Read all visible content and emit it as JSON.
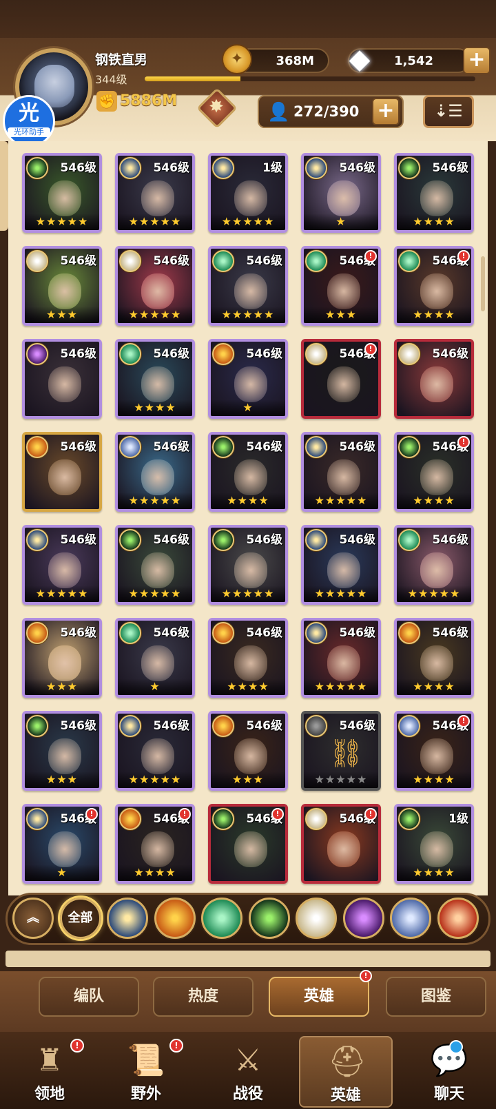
{
  "player": {
    "name": "钢铁直男",
    "level": "344级",
    "level_progress": 0.29,
    "power": "5886M"
  },
  "helper_badge": {
    "glyph": "光",
    "label": "光环助手"
  },
  "currency": {
    "gold": "368M",
    "diamonds": "1,542"
  },
  "roster": {
    "count": "272/390"
  },
  "icons": {
    "plus": "+",
    "sort": "⇣☰",
    "coin": "✦",
    "gem": "◆",
    "person": "👤",
    "power": "✊",
    "emblem_star": "✸",
    "chain": "⛓",
    "alert": "!"
  },
  "heroes": [
    {
      "faction": "graveborn",
      "level": "546级",
      "stars": "★★★★★",
      "border": "purple",
      "hue": "#3a5a2a",
      "alert": false
    },
    {
      "faction": "lightbearer-star",
      "level": "546级",
      "stars": "★★★★★",
      "border": "purple",
      "hue": "#3a3a4a",
      "alert": false
    },
    {
      "faction": "lightbearer-star",
      "level": "1级",
      "stars": "★★★★★",
      "border": "purple",
      "hue": "#2a2a38",
      "alert": false
    },
    {
      "faction": "lightbearer-star",
      "level": "546级",
      "stars": "★",
      "border": "purple",
      "hue": "#7a6a8a",
      "alert": false
    },
    {
      "faction": "graveborn",
      "level": "546级",
      "stars": "★★★★",
      "border": "purple",
      "hue": "#2a3a3a",
      "alert": false
    },
    {
      "faction": "celestial",
      "level": "546级",
      "stars": "★★★",
      "border": "purple",
      "hue": "#6a8a3a",
      "alert": false
    },
    {
      "faction": "celestial",
      "level": "546级",
      "stars": "★★★★★",
      "border": "purple",
      "hue": "#a03a4a",
      "alert": false
    },
    {
      "faction": "wilder",
      "level": "546级",
      "stars": "★★★★★",
      "border": "purple",
      "hue": "#3a3a48",
      "alert": false
    },
    {
      "faction": "wilder",
      "level": "546级",
      "stars": "★★★",
      "border": "purple",
      "hue": "#3a1a1a",
      "alert": true
    },
    {
      "faction": "wilder",
      "level": "546级",
      "stars": "★★★★",
      "border": "purple",
      "hue": "#5a3a2a",
      "alert": true
    },
    {
      "faction": "hypogean",
      "level": "546级",
      "stars": "",
      "border": "purple",
      "hue": "#3a3038",
      "alert": false
    },
    {
      "faction": "wilder",
      "level": "546级",
      "stars": "★★★★",
      "border": "purple",
      "hue": "#2a4a5a",
      "alert": false
    },
    {
      "faction": "mauler",
      "level": "546级",
      "stars": "★",
      "border": "purple",
      "hue": "#2a2a4a",
      "alert": false
    },
    {
      "faction": "celestial",
      "level": "546级",
      "stars": "",
      "border": "red",
      "hue": "#1a1a1a",
      "alert": true
    },
    {
      "faction": "celestial",
      "level": "546级",
      "stars": "",
      "border": "red",
      "hue": "#8a3a3a",
      "alert": false
    },
    {
      "faction": "mauler",
      "level": "546级",
      "stars": "",
      "border": "gold",
      "hue": "#6a4a2a",
      "alert": false
    },
    {
      "faction": "dimensional",
      "level": "546级",
      "stars": "★★★★★",
      "border": "purple",
      "hue": "#3a6a8a",
      "alert": false
    },
    {
      "faction": "graveborn",
      "level": "546级",
      "stars": "★★★★",
      "border": "purple",
      "hue": "#2a2a2a",
      "alert": false
    },
    {
      "faction": "lightbearer-star",
      "level": "546级",
      "stars": "★★★★★",
      "border": "purple",
      "hue": "#3a2a28",
      "alert": false
    },
    {
      "faction": "graveborn",
      "level": "546级",
      "stars": "★★★★",
      "border": "purple",
      "hue": "#2a3028",
      "alert": true
    },
    {
      "faction": "lightbearer-star",
      "level": "546级",
      "stars": "★★★★★",
      "border": "purple",
      "hue": "#4a3a5a",
      "alert": false
    },
    {
      "faction": "graveborn",
      "level": "546级",
      "stars": "★★★★★",
      "border": "purple",
      "hue": "#3a4a3a",
      "alert": false
    },
    {
      "faction": "graveborn",
      "level": "546级",
      "stars": "★★★★★",
      "border": "purple",
      "hue": "#4a4a4a",
      "alert": false
    },
    {
      "faction": "lightbearer-star",
      "level": "546级",
      "stars": "★★★★★",
      "border": "purple",
      "hue": "#2a3a5a",
      "alert": false
    },
    {
      "faction": "wilder",
      "level": "546级",
      "stars": "★★★★★",
      "border": "purple",
      "hue": "#8a5a6a",
      "alert": false
    },
    {
      "faction": "mauler",
      "level": "546级",
      "stars": "★★★",
      "border": "purple",
      "hue": "#c0a070",
      "alert": false
    },
    {
      "faction": "wilder",
      "level": "546级",
      "stars": "★",
      "border": "purple",
      "hue": "#3a3a4a",
      "alert": false
    },
    {
      "faction": "mauler",
      "level": "546级",
      "stars": "★★★★",
      "border": "purple",
      "hue": "#3a2a20",
      "alert": false
    },
    {
      "faction": "lightbearer-star",
      "level": "546级",
      "stars": "★★★★★",
      "border": "purple",
      "hue": "#6a2a2a",
      "alert": false
    },
    {
      "faction": "mauler",
      "level": "546级",
      "stars": "★★★★",
      "border": "purple",
      "hue": "#4a3a20",
      "alert": false
    },
    {
      "faction": "graveborn",
      "level": "546级",
      "stars": "★★★",
      "border": "purple",
      "hue": "#2a3a4a",
      "alert": false
    },
    {
      "faction": "lightbearer-star",
      "level": "546级",
      "stars": "★★★★★",
      "border": "purple",
      "hue": "#2a2a38",
      "alert": false
    },
    {
      "faction": "mauler",
      "level": "546级",
      "stars": "★★★",
      "border": "purple",
      "hue": "#3a2418",
      "alert": false
    },
    {
      "faction": "gray",
      "level": "546级",
      "stars": "★★★★★",
      "border": "gray",
      "hue": "#2e2e2e",
      "alert": false,
      "locked": true
    },
    {
      "faction": "dimensional",
      "level": "546级",
      "stars": "★★★★",
      "border": "purple",
      "hue": "#3a2418",
      "alert": true
    },
    {
      "faction": "lightbearer-star",
      "level": "546级",
      "stars": "★",
      "border": "purple",
      "hue": "#2a4a6a",
      "alert": true
    },
    {
      "faction": "mauler",
      "level": "546级",
      "stars": "★★★★",
      "border": "purple",
      "hue": "#2a2420",
      "alert": true
    },
    {
      "faction": "graveborn",
      "level": "546级",
      "stars": "",
      "border": "red",
      "hue": "#2a3a2a",
      "alert": true
    },
    {
      "faction": "celestial",
      "level": "546级",
      "stars": "",
      "border": "red",
      "hue": "#8a3a20",
      "alert": true
    },
    {
      "faction": "graveborn",
      "level": "1级",
      "stars": "★★★★",
      "border": "purple",
      "hue": "#3a4a38",
      "alert": false
    }
  ],
  "filters": [
    {
      "name": "collapse",
      "label": "︽"
    },
    {
      "name": "all",
      "label": "全部"
    },
    {
      "name": "lightbearer",
      "label": ""
    },
    {
      "name": "mauler",
      "label": ""
    },
    {
      "name": "wilder",
      "label": ""
    },
    {
      "name": "graveborn",
      "label": ""
    },
    {
      "name": "celestial",
      "label": ""
    },
    {
      "name": "hypogean",
      "label": ""
    },
    {
      "name": "dimensional",
      "label": ""
    },
    {
      "name": "flame",
      "label": ""
    }
  ],
  "section_tabs": [
    "编队",
    "热度",
    "英雄",
    "图鉴"
  ],
  "nav": [
    "领地",
    "野外",
    "战役",
    "英雄",
    "聊天"
  ]
}
